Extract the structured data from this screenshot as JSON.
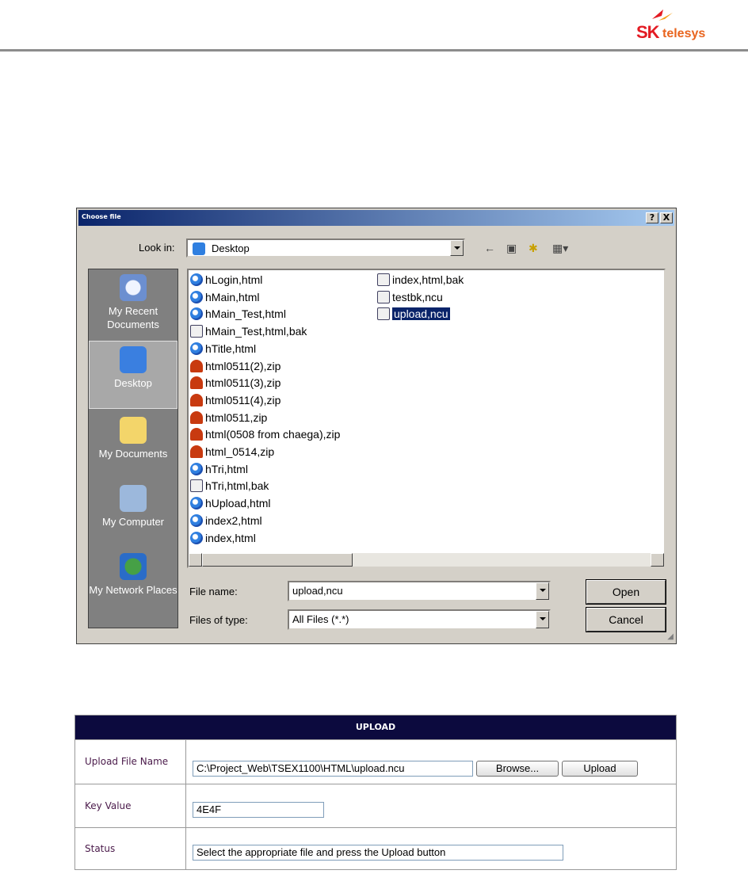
{
  "logo": {
    "brand": "SK",
    "product": "telesys"
  },
  "dialog": {
    "title": "Choose file",
    "help_btn": "?",
    "close_btn": "X",
    "look_in_label": "Look in:",
    "look_in_value": "Desktop",
    "places": [
      {
        "label": "My Recent Documents"
      },
      {
        "label": "Desktop"
      },
      {
        "label": "My Documents"
      },
      {
        "label": "My Computer"
      },
      {
        "label": "My Network Places"
      }
    ],
    "files": [
      {
        "name": "hLogin,html",
        "icon": "ie-icon"
      },
      {
        "name": "hMain,html",
        "icon": "ie-icon"
      },
      {
        "name": "hMain_Test,html",
        "icon": "ie-icon"
      },
      {
        "name": "hMain_Test,html,bak",
        "icon": "bak-icon"
      },
      {
        "name": "hTitle,html",
        "icon": "ie-icon"
      },
      {
        "name": "html0511(2),zip",
        "icon": "zip-icon"
      },
      {
        "name": "html0511(3),zip",
        "icon": "zip-icon"
      },
      {
        "name": "html0511(4),zip",
        "icon": "zip-icon"
      },
      {
        "name": "html0511,zip",
        "icon": "zip-icon"
      },
      {
        "name": "html(0508 from chaega),zip",
        "icon": "zip-icon"
      },
      {
        "name": "html_0514,zip",
        "icon": "zip-icon"
      },
      {
        "name": "hTri,html",
        "icon": "ie-icon"
      },
      {
        "name": "hTri,html,bak",
        "icon": "bak-icon"
      },
      {
        "name": "hUpload,html",
        "icon": "ie-icon"
      },
      {
        "name": "index2,html",
        "icon": "ie-icon"
      },
      {
        "name": "index,html",
        "icon": "ie-icon"
      },
      {
        "name": "index,html,bak",
        "icon": "bak-icon"
      },
      {
        "name": "testbk,ncu",
        "icon": "bak-icon"
      },
      {
        "name": "upload,ncu",
        "icon": "bak-icon",
        "selected": true
      }
    ],
    "file_name_label": "File name:",
    "file_name_value": "upload,ncu",
    "files_of_type_label": "Files of type:",
    "files_of_type_value": "All Files (*.*)",
    "open_btn": "Open",
    "cancel_btn": "Cancel"
  },
  "upload": {
    "title": "UPLOAD",
    "file_name_label": "Upload File Name",
    "file_name_value": "C:\\Project_Web\\TSEX1100\\HTML\\upload.ncu",
    "browse_btn": "Browse...",
    "upload_btn": "Upload",
    "key_label": "Key Value",
    "key_value": "4E4F",
    "status_label": "Status",
    "status_value": "Select the appropriate file and press the Upload button"
  },
  "colors": {
    "header_rule": "#8c8c8c",
    "title_bar": "#0a246a",
    "upload_header": "#0c0a3e",
    "selection": "#0a246a"
  }
}
